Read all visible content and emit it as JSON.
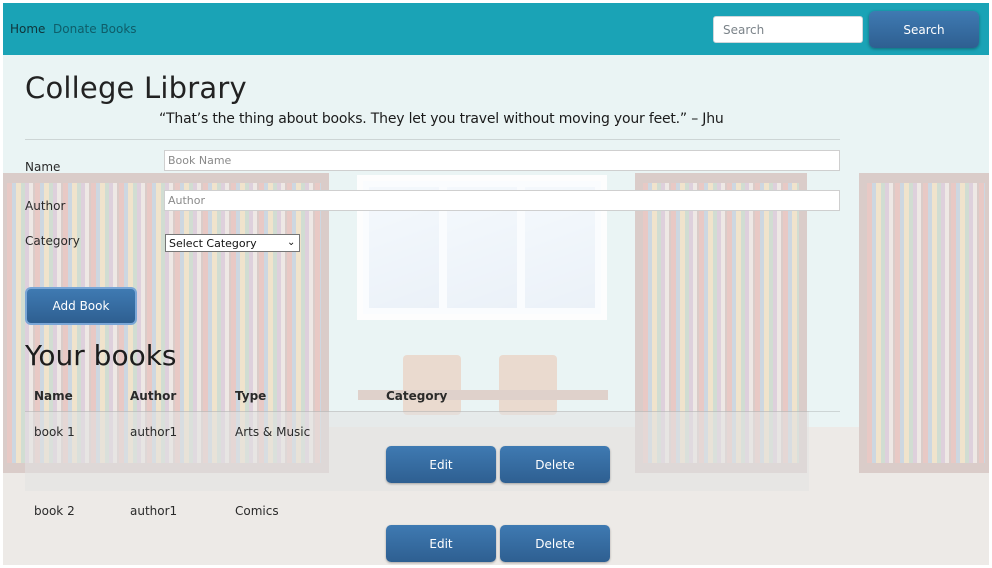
{
  "navbar": {
    "home_label": "Home",
    "donate_label": "Donate Books",
    "search_placeholder": "Search",
    "search_button": "Search"
  },
  "page": {
    "title": "College Library",
    "quote": "“That’s the thing about books. They let you travel without moving your feet.” – Jhu"
  },
  "form": {
    "name_label": "Name",
    "name_placeholder": "Book Name",
    "author_label": "Author",
    "author_placeholder": "Author",
    "category_label": "Category",
    "category_selected": "Select Category",
    "add_button": "Add Book"
  },
  "books": {
    "heading": "Your books",
    "columns": [
      "Name",
      "Author",
      "Type",
      "Category"
    ],
    "rows": [
      {
        "name": "book 1",
        "author": "author1",
        "type": "Arts & Music",
        "edit": "Edit",
        "delete": "Delete"
      },
      {
        "name": "book 2",
        "author": "author1",
        "type": "Comics",
        "edit": "Edit",
        "delete": "Delete"
      }
    ]
  },
  "colors": {
    "navbar": "#1aa3b6",
    "button": "#3a6ea5"
  }
}
